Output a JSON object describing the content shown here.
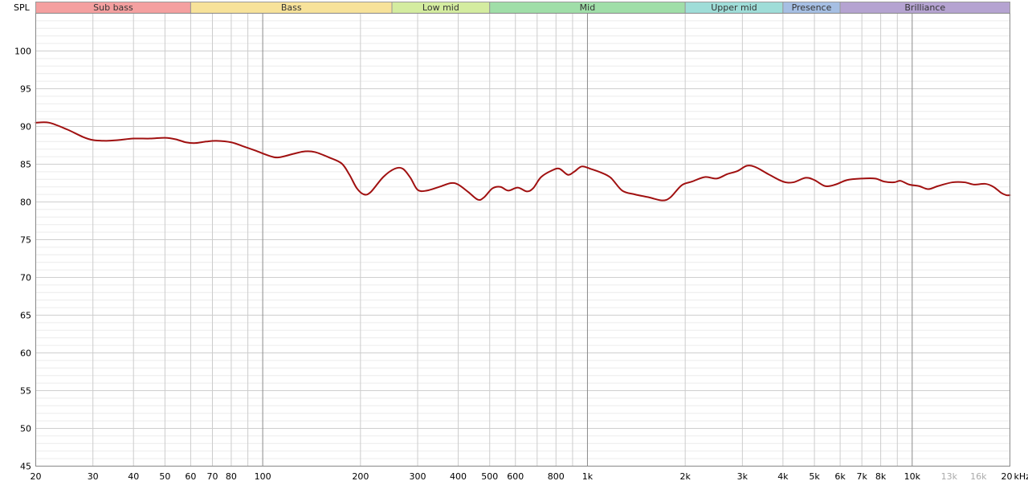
{
  "chart_data": {
    "type": "line",
    "ylabel": "SPL",
    "x_unit_label": "kHz",
    "x_scale": "log",
    "xlim": [
      20,
      20000
    ],
    "ylim": [
      45,
      105
    ],
    "y_ticks": [
      45,
      50,
      55,
      60,
      65,
      70,
      75,
      80,
      85,
      90,
      95,
      100
    ],
    "y_minor_step": 1,
    "grid": true,
    "x_ticks": [
      {
        "value": 20,
        "label": "20"
      },
      {
        "value": 30,
        "label": "30"
      },
      {
        "value": 40,
        "label": "40"
      },
      {
        "value": 50,
        "label": "50"
      },
      {
        "value": 60,
        "label": "60"
      },
      {
        "value": 70,
        "label": "70"
      },
      {
        "value": 80,
        "label": "80"
      },
      {
        "value": 100,
        "label": "100"
      },
      {
        "value": 200,
        "label": "200"
      },
      {
        "value": 300,
        "label": "300"
      },
      {
        "value": 400,
        "label": "400"
      },
      {
        "value": 500,
        "label": "500"
      },
      {
        "value": 600,
        "label": "600"
      },
      {
        "value": 800,
        "label": "800"
      },
      {
        "value": 1000,
        "label": "1k"
      },
      {
        "value": 2000,
        "label": "2k"
      },
      {
        "value": 3000,
        "label": "3k"
      },
      {
        "value": 4000,
        "label": "4k"
      },
      {
        "value": 5000,
        "label": "5k"
      },
      {
        "value": 6000,
        "label": "6k"
      },
      {
        "value": 7000,
        "label": "7k"
      },
      {
        "value": 8000,
        "label": "8k"
      },
      {
        "value": 10000,
        "label": "10k"
      },
      {
        "value": 13000,
        "label": "13k",
        "muted": true
      },
      {
        "value": 16000,
        "label": "16k",
        "muted": true
      },
      {
        "value": 20000,
        "label": "20"
      }
    ],
    "bands": [
      {
        "label": "Sub bass",
        "from": 20,
        "to": 60,
        "color": "#f4a0a0"
      },
      {
        "label": "Bass",
        "from": 60,
        "to": 250,
        "color": "#f7e29a"
      },
      {
        "label": "Low mid",
        "from": 250,
        "to": 500,
        "color": "#d4eca0"
      },
      {
        "label": "Mid",
        "from": 500,
        "to": 2000,
        "color": "#a0dea8"
      },
      {
        "label": "Upper mid",
        "from": 2000,
        "to": 4000,
        "color": "#9fddd8"
      },
      {
        "label": "Presence",
        "from": 4000,
        "to": 6000,
        "color": "#a6bfe3"
      },
      {
        "label": "Brilliance",
        "from": 6000,
        "to": 20000,
        "color": "#b5a3d1"
      }
    ],
    "series": [
      {
        "color": "#a01010",
        "points": [
          [
            20,
            90.5
          ],
          [
            22,
            90.5
          ],
          [
            25,
            89.6
          ],
          [
            28,
            88.6
          ],
          [
            30,
            88.2
          ],
          [
            33,
            88.1
          ],
          [
            36,
            88.2
          ],
          [
            40,
            88.4
          ],
          [
            45,
            88.4
          ],
          [
            50,
            88.5
          ],
          [
            54,
            88.3
          ],
          [
            58,
            87.9
          ],
          [
            62,
            87.8
          ],
          [
            67,
            88.0
          ],
          [
            72,
            88.1
          ],
          [
            80,
            87.9
          ],
          [
            88,
            87.3
          ],
          [
            95,
            86.8
          ],
          [
            105,
            86.1
          ],
          [
            112,
            85.9
          ],
          [
            125,
            86.4
          ],
          [
            135,
            86.7
          ],
          [
            145,
            86.6
          ],
          [
            160,
            85.9
          ],
          [
            175,
            85.1
          ],
          [
            185,
            83.6
          ],
          [
            195,
            81.8
          ],
          [
            205,
            81.0
          ],
          [
            215,
            81.3
          ],
          [
            235,
            83.3
          ],
          [
            255,
            84.4
          ],
          [
            270,
            84.4
          ],
          [
            285,
            83.2
          ],
          [
            300,
            81.6
          ],
          [
            320,
            81.5
          ],
          [
            350,
            82.0
          ],
          [
            380,
            82.5
          ],
          [
            400,
            82.3
          ],
          [
            430,
            81.3
          ],
          [
            460,
            80.3
          ],
          [
            480,
            80.6
          ],
          [
            510,
            81.8
          ],
          [
            540,
            82.0
          ],
          [
            570,
            81.5
          ],
          [
            610,
            81.9
          ],
          [
            650,
            81.4
          ],
          [
            680,
            81.8
          ],
          [
            720,
            83.3
          ],
          [
            780,
            84.2
          ],
          [
            820,
            84.4
          ],
          [
            870,
            83.6
          ],
          [
            910,
            84.0
          ],
          [
            960,
            84.7
          ],
          [
            1020,
            84.4
          ],
          [
            1100,
            83.9
          ],
          [
            1180,
            83.2
          ],
          [
            1280,
            81.5
          ],
          [
            1400,
            81.0
          ],
          [
            1550,
            80.6
          ],
          [
            1700,
            80.2
          ],
          [
            1800,
            80.6
          ],
          [
            1950,
            82.2
          ],
          [
            2100,
            82.7
          ],
          [
            2300,
            83.3
          ],
          [
            2500,
            83.1
          ],
          [
            2700,
            83.7
          ],
          [
            2900,
            84.1
          ],
          [
            3100,
            84.8
          ],
          [
            3300,
            84.6
          ],
          [
            3600,
            83.7
          ],
          [
            4000,
            82.7
          ],
          [
            4300,
            82.6
          ],
          [
            4700,
            83.2
          ],
          [
            5000,
            82.9
          ],
          [
            5400,
            82.1
          ],
          [
            5800,
            82.3
          ],
          [
            6300,
            82.9
          ],
          [
            7000,
            83.1
          ],
          [
            7700,
            83.1
          ],
          [
            8200,
            82.7
          ],
          [
            8800,
            82.6
          ],
          [
            9200,
            82.8
          ],
          [
            9800,
            82.3
          ],
          [
            10500,
            82.1
          ],
          [
            11200,
            81.7
          ],
          [
            12000,
            82.1
          ],
          [
            13300,
            82.6
          ],
          [
            14500,
            82.6
          ],
          [
            15500,
            82.3
          ],
          [
            16800,
            82.4
          ],
          [
            17800,
            82.0
          ],
          [
            18800,
            81.2
          ],
          [
            19500,
            80.9
          ],
          [
            20000,
            80.9
          ]
        ]
      }
    ]
  }
}
